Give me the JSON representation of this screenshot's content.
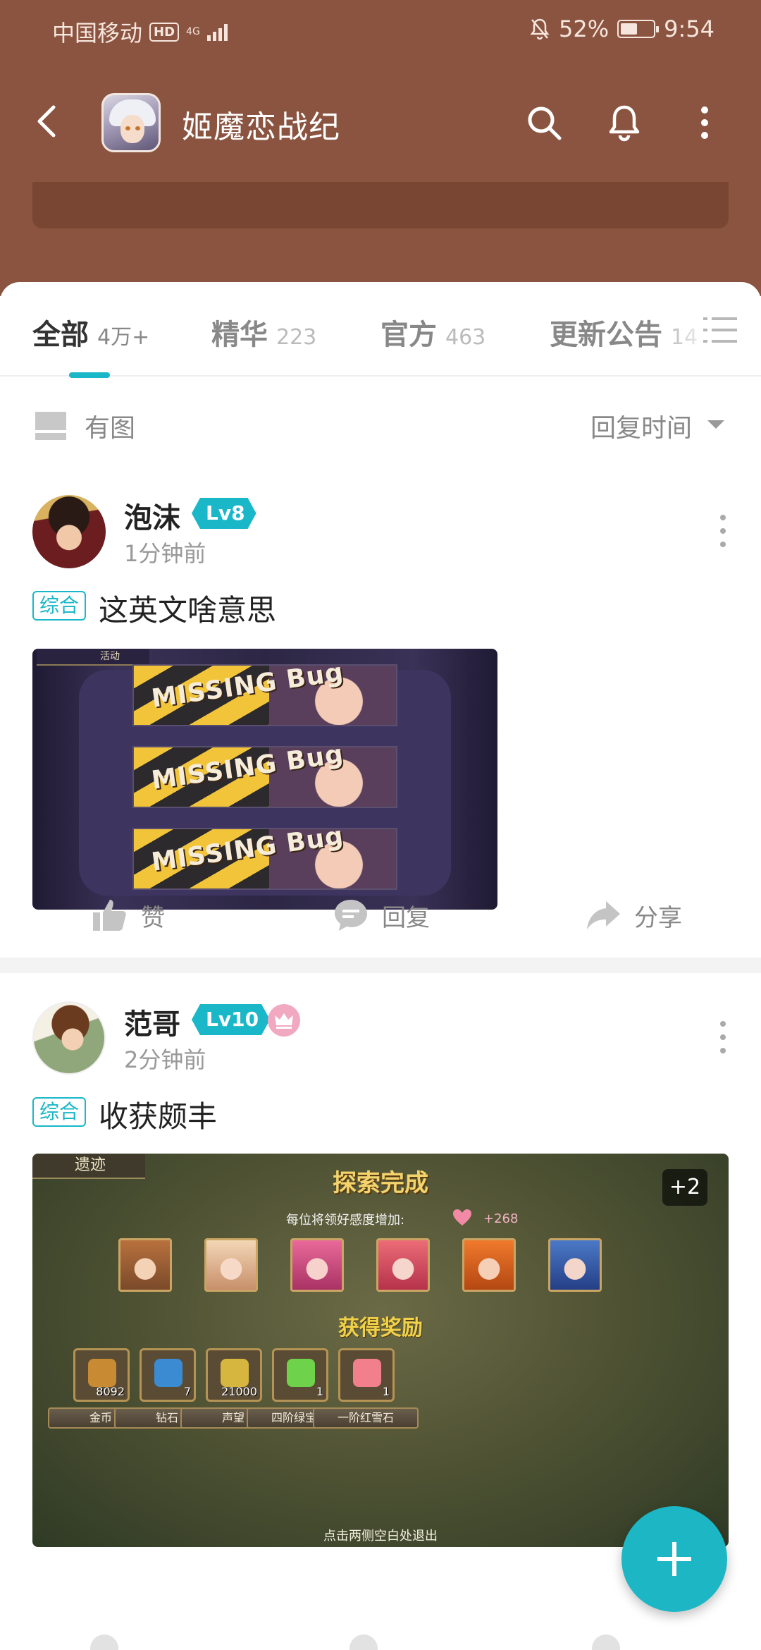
{
  "status_bar": {
    "carrier": "中国移动",
    "hd_badge": "HD",
    "network": "4G",
    "battery_percent": "52%",
    "battery_level": 0.52,
    "time": "9:54"
  },
  "header": {
    "back_icon": "back-arrow-icon",
    "title": "姬魔恋战纪",
    "icons": [
      "search-icon",
      "bell-icon",
      "more-vertical-icon"
    ]
  },
  "tabs": [
    {
      "label": "全部",
      "count": "4万+",
      "active": true
    },
    {
      "label": "精华",
      "count": "223",
      "active": false
    },
    {
      "label": "官方",
      "count": "463",
      "active": false
    },
    {
      "label": "更新公告",
      "count": "14",
      "active": false
    }
  ],
  "filter": {
    "image_filter_label": "有图",
    "sort_label": "回复时间"
  },
  "posts": [
    {
      "username": "泡沫",
      "level": "Lv8",
      "time": "1分钟前",
      "tag": "综合",
      "title": "这英文啥意思",
      "image": {
        "tab_label": "活动",
        "strips": [
          "MISSING Bug",
          "MISSING Bug",
          "MISSING Bug"
        ]
      },
      "actions": {
        "like": "赞",
        "reply": "回复",
        "share": "分享"
      }
    },
    {
      "username": "范哥",
      "level": "Lv10",
      "time": "2分钟前",
      "tag": "综合",
      "title": "收获颇丰",
      "image": {
        "chip": "遗迹",
        "heading": "探索完成",
        "subtitle": "每位将领好感度增加:",
        "favor": "+268",
        "extra_images": "+2",
        "reward_title": "获得奖励",
        "rewards": [
          {
            "name": "金币",
            "count": "8092"
          },
          {
            "name": "钻石",
            "count": "7"
          },
          {
            "name": "声望",
            "count": "21000"
          },
          {
            "name": "四阶绿宝石",
            "count": "1"
          },
          {
            "name": "一阶红雪石",
            "count": "1"
          }
        ],
        "footer_hint": "点击两侧空白处退出"
      }
    }
  ],
  "fab_icon": "plus-icon",
  "colors": {
    "header_bg": "#8a5440",
    "accent": "#19b7c8",
    "fab": "#1cb6c5"
  }
}
